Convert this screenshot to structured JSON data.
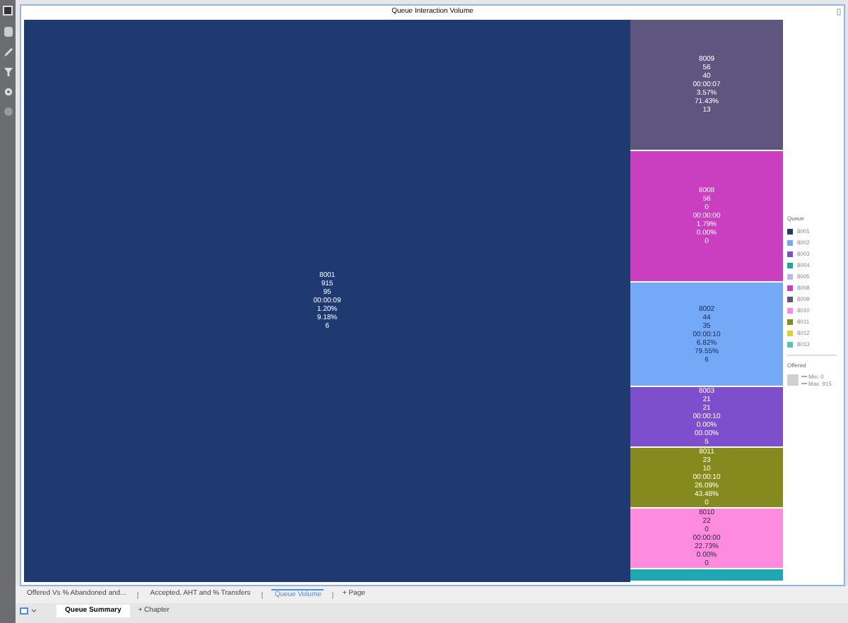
{
  "title": "Queue Interaction Volume",
  "main_tile": {
    "color": "#1f3a70",
    "lines": [
      "8001",
      "915",
      "95",
      "00:00:09",
      "1.20%",
      "9.18%",
      "6"
    ]
  },
  "tiles": [
    {
      "color": "#5e567f",
      "lines": [
        "8009",
        "56",
        "40",
        "00:00:07",
        "3.57%",
        "71.43%",
        "13"
      ]
    },
    {
      "color": "#c93fbf",
      "lines": [
        "8008",
        "56",
        "0",
        "00:00:00",
        "1.79%",
        "0.00%",
        "0"
      ]
    },
    {
      "color": "#74a9f7",
      "lines": [
        "8002",
        "44",
        "35",
        "00:00:10",
        "6.82%",
        "79.55%",
        "6"
      ]
    },
    {
      "color": "#7e4fcc",
      "lines": [
        "8003",
        "21",
        "21",
        "00:00:10",
        "0.00%",
        "00.00%",
        "5"
      ]
    },
    {
      "color": "#858a1e",
      "lines": [
        "8011",
        "23",
        "10",
        "00:00:10",
        "26.09%",
        "43.48%",
        "0"
      ]
    },
    {
      "color": "#ff8bde",
      "lines": [
        "8010",
        "22",
        "0",
        "00:00:00",
        "22.73%",
        "0.00%",
        "0"
      ]
    },
    {
      "color": "#1fa8b3"
    }
  ],
  "legend": {
    "title": "Queue",
    "items": [
      {
        "label": "8001",
        "color": "#1f3a70"
      },
      {
        "label": "8002",
        "color": "#74a9f7"
      },
      {
        "label": "8003",
        "color": "#7e4fcc"
      },
      {
        "label": "8004",
        "color": "#1fa5a9"
      },
      {
        "label": "8005",
        "color": "#b9b9ec"
      },
      {
        "label": "8008",
        "color": "#c93fbf"
      },
      {
        "label": "8009",
        "color": "#5e567f"
      },
      {
        "label": "8010",
        "color": "#ff8bde"
      },
      {
        "label": "8011",
        "color": "#858a1e"
      },
      {
        "label": "8012",
        "color": "#d9d32a"
      },
      {
        "label": "8013",
        "color": "#5bbfbf"
      }
    ]
  },
  "size_legend": {
    "title": "Offered",
    "min": "Min: 0",
    "max": "Max: 915"
  },
  "page_tabs": [
    {
      "label": "Offered Vs % Abandoned and...",
      "selected": false
    },
    {
      "label": "Accepted, AHT and % Transfers",
      "selected": false
    },
    {
      "label": "Queue Volume",
      "selected": true
    }
  ],
  "add_page": "+ Page",
  "chapter_tabs": [
    {
      "label": "Queue Summary",
      "selected": true
    }
  ],
  "add_chapter": "+ Chapter"
}
